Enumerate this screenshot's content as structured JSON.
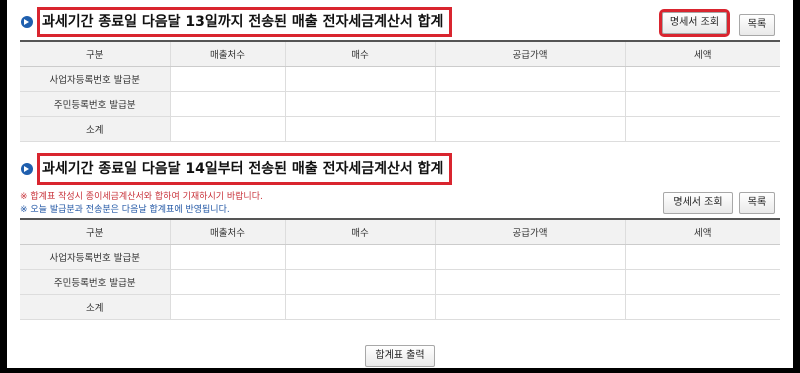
{
  "section1": {
    "title": "과세기간 종료일 다음달 13일까지 전송된 매출 전자세금계산서 합계",
    "detail_button": "명세서 조회",
    "list_button": "목록",
    "columns": [
      "구분",
      "매출처수",
      "매수",
      "공급가액",
      "세액"
    ],
    "rows": [
      "사업자등록번호 발급분",
      "주민등록번호 발급분",
      "소계"
    ]
  },
  "section2": {
    "title": "과세기간 종료일 다음달 14일부터 전송된 매출 전자세금계산서 합계",
    "note1": "※ 합계표 작성시 종이세금계산서와 합하여 기재하시기 바랍니다.",
    "note2": "※ 오늘 발급분과 전송분은 다음날 합계표에 반영됩니다.",
    "detail_button": "명세서 조회",
    "list_button": "목록",
    "columns": [
      "구분",
      "매출처수",
      "매수",
      "공급가액",
      "세액"
    ],
    "rows": [
      "사업자등록번호 발급분",
      "주민등록번호 발급분",
      "소계"
    ]
  },
  "print_button": "합계표 출력",
  "colors": {
    "highlight": "#d9252f",
    "bullet": "#1f5fae"
  }
}
